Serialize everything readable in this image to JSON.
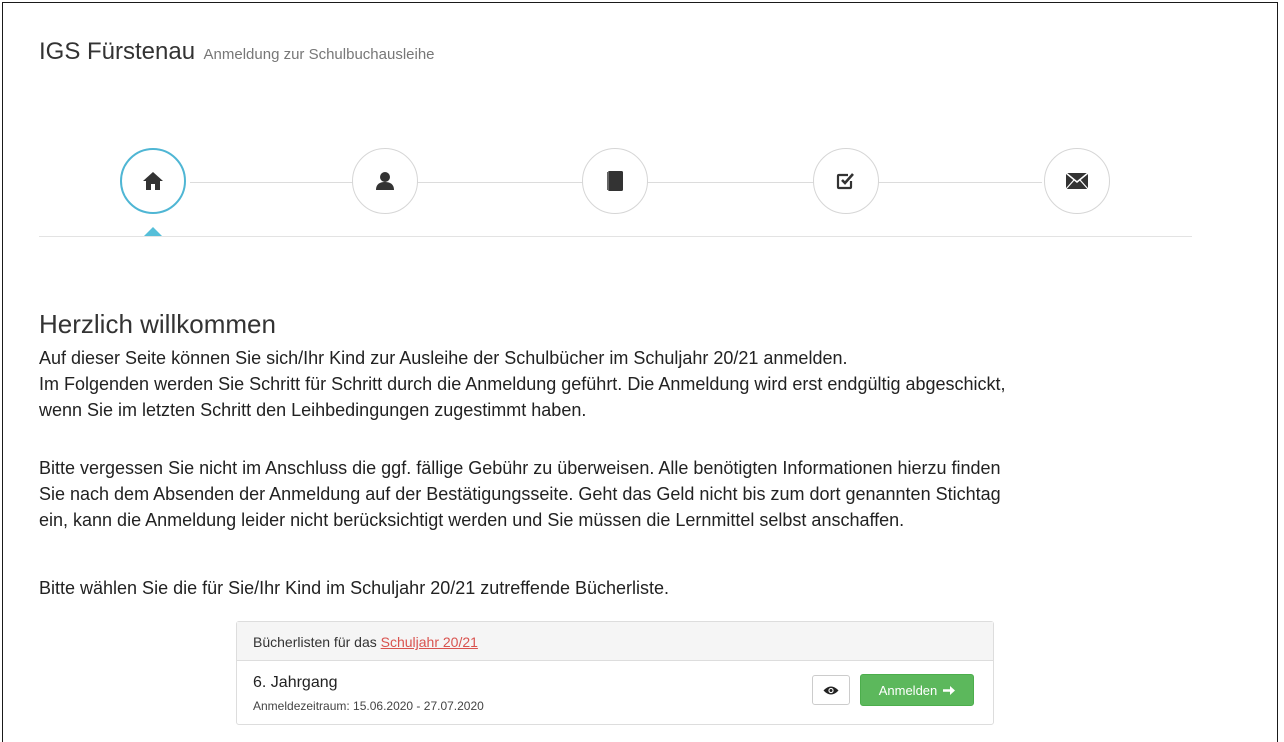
{
  "header": {
    "brand": "IGS Fürstenau",
    "subtitle": "Anmeldung zur Schulbuchausleihe"
  },
  "steps": [
    {
      "icon": "home-icon",
      "active": true
    },
    {
      "icon": "user-icon",
      "active": false
    },
    {
      "icon": "book-icon",
      "active": false
    },
    {
      "icon": "check-square-icon",
      "active": false
    },
    {
      "icon": "envelope-icon",
      "active": false
    }
  ],
  "main": {
    "heading": "Herzlich willkommen",
    "intro_line1": "Auf dieser Seite können Sie sich/Ihr Kind zur Ausleihe der Schulbücher im Schuljahr 20/21 anmelden.",
    "intro_line2": "Im Folgenden werden Sie Schritt für Schritt durch die Anmeldung geführt. Die Anmeldung wird erst endgültig abgeschickt,",
    "intro_line3": "wenn Sie im letzten Schritt den Leihbedingungen zugestimmt haben.",
    "fee_line1": "Bitte vergessen Sie nicht im Anschluss die ggf. fällige Gebühr zu überweisen. Alle benötigten Informationen hierzu finden",
    "fee_line2": "Sie nach dem Absenden der Anmeldung auf der Bestätigungsseite. Geht das Geld nicht bis zum dort genannten Stichtag",
    "fee_line3": "ein, kann die Anmeldung leider nicht berücksichtigt werden und Sie müssen die Lernmittel selbst anschaffen.",
    "choose_text": "Bitte wählen Sie die für Sie/Ihr Kind im Schuljahr 20/21 zutreffende Bücherliste."
  },
  "booklist": {
    "header_prefix": "Bücherlisten für das",
    "header_link": "Schuljahr 20/21",
    "rows": [
      {
        "title": "6. Jahrgang",
        "period": "Anmeldezeitraum: 15.06.2020 - 27.07.2020",
        "view_icon": "eye-icon",
        "register_label": "Anmelden",
        "register_icon": "arrow-right-icon"
      }
    ]
  },
  "colors": {
    "accent": "#4fb6d4",
    "success": "#5cb85c",
    "link": "#d9534f"
  }
}
